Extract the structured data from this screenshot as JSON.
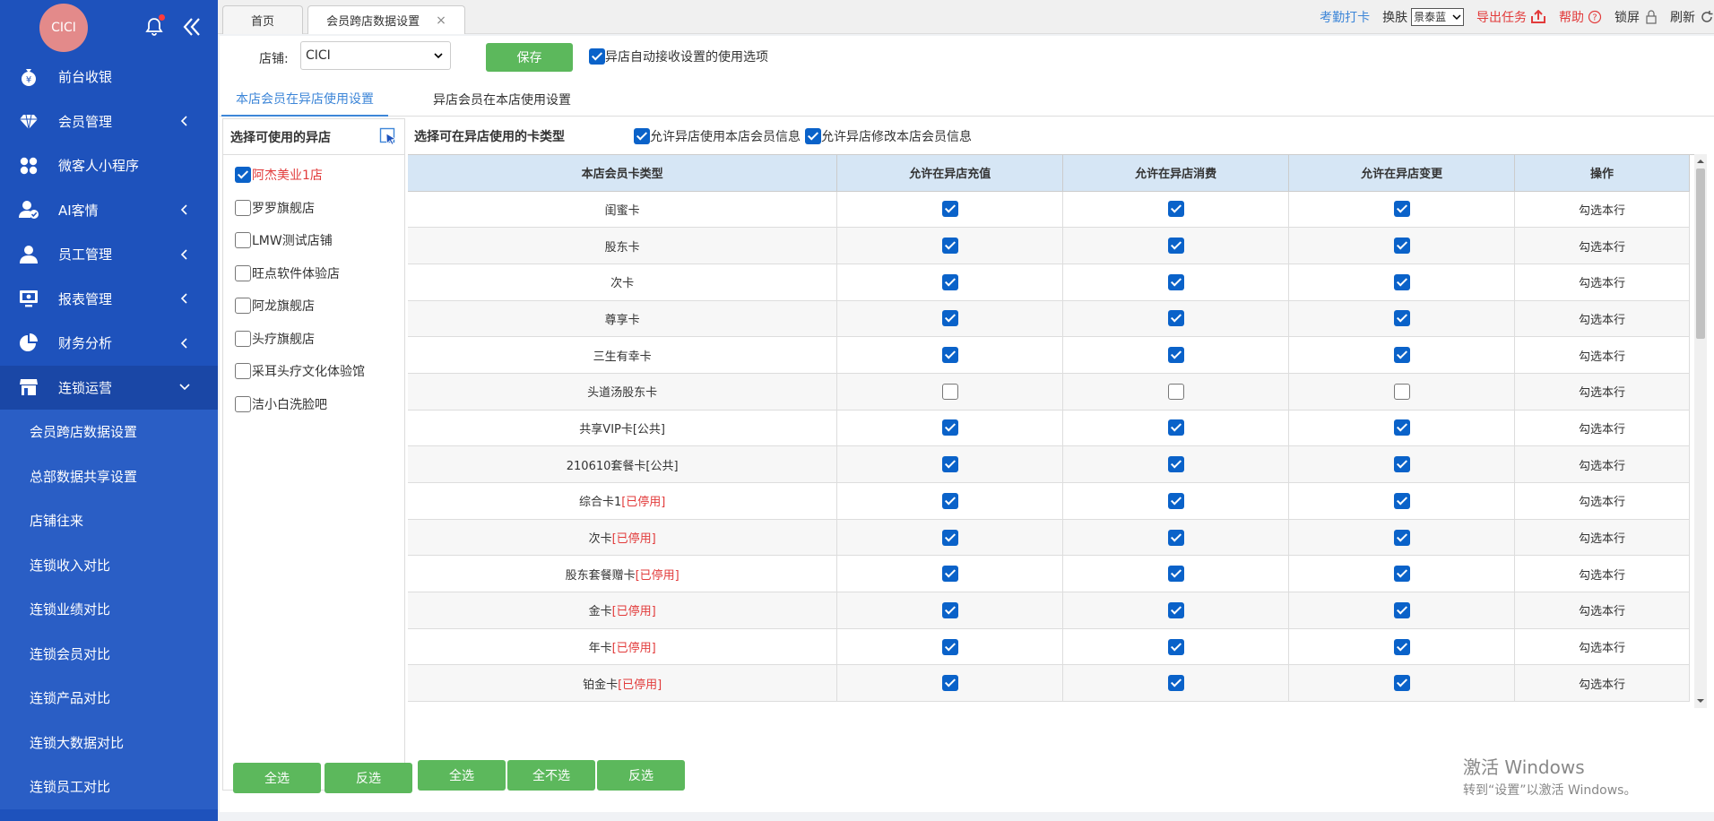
{
  "user": {
    "avatar_text": "CICI"
  },
  "sidebar": {
    "items": [
      {
        "label": "前台收银",
        "icon": "money-bag-icon",
        "has_arrow": false
      },
      {
        "label": "会员管理",
        "icon": "diamond-icon",
        "has_arrow": true
      },
      {
        "label": "微客人小程序",
        "icon": "apps-icon",
        "has_arrow": false
      },
      {
        "label": "AI客情",
        "icon": "user-check-icon",
        "has_arrow": true
      },
      {
        "label": "员工管理",
        "icon": "user-icon",
        "has_arrow": true
      },
      {
        "label": "报表管理",
        "icon": "monitor-icon",
        "has_arrow": true
      },
      {
        "label": "财务分析",
        "icon": "pie-chart-icon",
        "has_arrow": true
      },
      {
        "label": "连锁运营",
        "icon": "store-icon",
        "has_arrow": true,
        "open": true
      }
    ],
    "sub_items": [
      "会员跨店数据设置",
      "总部数据共享设置",
      "店铺往来",
      "连锁收入对比",
      "连锁业绩对比",
      "连锁会员对比",
      "连锁产品对比",
      "连锁大数据对比",
      "连锁员工对比"
    ]
  },
  "tabs": {
    "home": "首页",
    "active": "会员跨店数据设置",
    "close": "×"
  },
  "topbar": {
    "attendance": "考勤打卡",
    "skin_label": "换肤",
    "skin_value": "景泰蓝",
    "export": "导出任务",
    "help": "帮助",
    "lock": "锁屏",
    "refresh": "刷新"
  },
  "form": {
    "store_label": "店铺:",
    "store_value": "CICI",
    "save": "保存",
    "auto_option": "异店自动接收设置的使用选项"
  },
  "subtabs": {
    "tab1": "本店会员在异店使用设置",
    "tab2": "异店会员在本店使用设置"
  },
  "store_panel": {
    "title": "选择可使用的异店",
    "stores": [
      {
        "name": "阿杰美业1店",
        "checked": true
      },
      {
        "name": "罗罗旗舰店",
        "checked": false
      },
      {
        "name": "LMW测试店铺",
        "checked": false
      },
      {
        "name": "旺点软件体验店",
        "checked": false
      },
      {
        "name": "阿龙旗舰店",
        "checked": false
      },
      {
        "name": "头疗旗舰店",
        "checked": false
      },
      {
        "name": "采耳头疗文化体验馆",
        "checked": false
      },
      {
        "name": "洁小白洗脸吧",
        "checked": false
      }
    ],
    "select_all": "全选",
    "invert": "反选"
  },
  "card_panel": {
    "title": "选择可在异店使用的卡类型",
    "allow_use_info": "允许异店使用本店会员信息",
    "allow_modify_info": "允许异店修改本店会员信息",
    "columns": [
      "本店会员卡类型",
      "允许在异店充值",
      "允许在异店消费",
      "允许在异店变更",
      "操作"
    ],
    "row_action": "勾选本行",
    "rows": [
      {
        "name": "闺蜜卡",
        "tag": "",
        "recharge": true,
        "consume": true,
        "change": true
      },
      {
        "name": "股东卡",
        "tag": "",
        "recharge": true,
        "consume": true,
        "change": true
      },
      {
        "name": "次卡",
        "tag": "",
        "recharge": true,
        "consume": true,
        "change": true
      },
      {
        "name": "尊享卡",
        "tag": "",
        "recharge": true,
        "consume": true,
        "change": true
      },
      {
        "name": "三生有幸卡",
        "tag": "",
        "recharge": true,
        "consume": true,
        "change": true
      },
      {
        "name": "头道汤股东卡",
        "tag": "",
        "recharge": false,
        "consume": false,
        "change": false
      },
      {
        "name": "共享VIP卡[公共]",
        "tag": "",
        "recharge": true,
        "consume": true,
        "change": true
      },
      {
        "name": "210610套餐卡[公共]",
        "tag": "",
        "recharge": true,
        "consume": true,
        "change": true
      },
      {
        "name": "综合卡1",
        "tag": "[已停用]",
        "recharge": true,
        "consume": true,
        "change": true
      },
      {
        "name": "次卡",
        "tag": "[已停用]",
        "recharge": true,
        "consume": true,
        "change": true
      },
      {
        "name": "股东套餐赠卡",
        "tag": "[已停用]",
        "recharge": true,
        "consume": true,
        "change": true
      },
      {
        "name": "金卡",
        "tag": "[已停用]",
        "recharge": true,
        "consume": true,
        "change": true
      },
      {
        "name": "年卡",
        "tag": "[已停用]",
        "recharge": true,
        "consume": true,
        "change": true
      },
      {
        "name": "铂金卡",
        "tag": "[已停用]",
        "recharge": true,
        "consume": true,
        "change": true
      }
    ],
    "select_all": "全选",
    "select_none": "全不选",
    "invert": "反选"
  },
  "watermark": {
    "line1": "激活 Windows",
    "line2": "转到“设置”以激活 Windows。"
  },
  "colors": {
    "sidebar": "#1e52bc",
    "accent": "#3d86d8",
    "button": "#5cb85c",
    "danger": "#e23b3b"
  }
}
